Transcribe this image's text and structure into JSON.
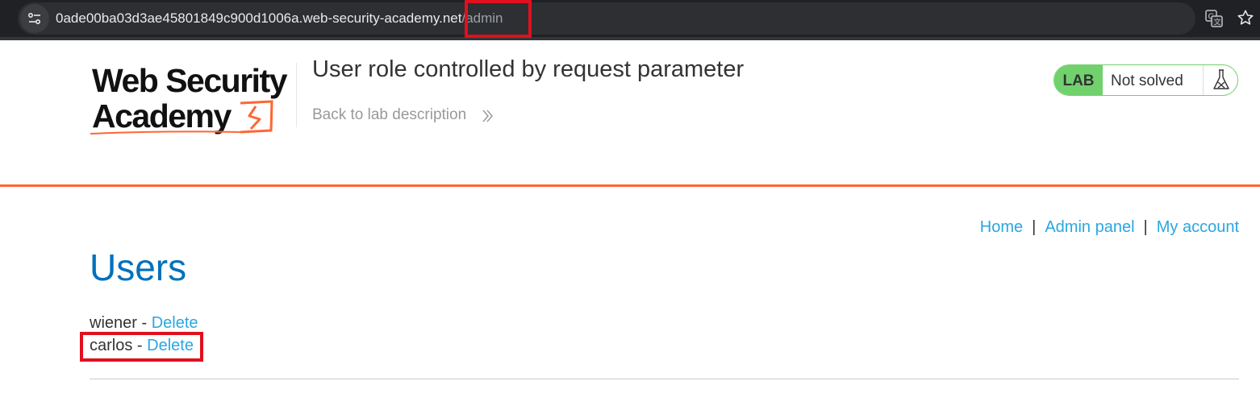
{
  "browser": {
    "url_host": "0ade00ba03d3ae45801849c900d1006a.web-security-academy.net",
    "url_path": "/admin"
  },
  "logo": {
    "line1": "Web Security",
    "line2": "Academy"
  },
  "lab": {
    "title": "User role controlled by request parameter",
    "back_link": "Back to lab description",
    "badge": "LAB",
    "status": "Not solved",
    "status_color": "#70d16d"
  },
  "nav": {
    "items": [
      "Home",
      "Admin panel",
      "My account"
    ],
    "separator": "|"
  },
  "page": {
    "heading": "Users",
    "users": [
      {
        "name": "wiener",
        "separator": " - ",
        "action": "Delete"
      },
      {
        "name": "carlos",
        "separator": " - ",
        "action": "Delete"
      }
    ]
  },
  "colors": {
    "accent_orange": "#ff6633",
    "link_blue": "#29a7e1",
    "heading_blue": "#0071bc",
    "annotation_red": "#e0101e"
  },
  "icons": [
    "site-settings-icon",
    "translate-icon",
    "bookmark-star-icon",
    "chevron-right-double-icon",
    "flask-icon"
  ]
}
